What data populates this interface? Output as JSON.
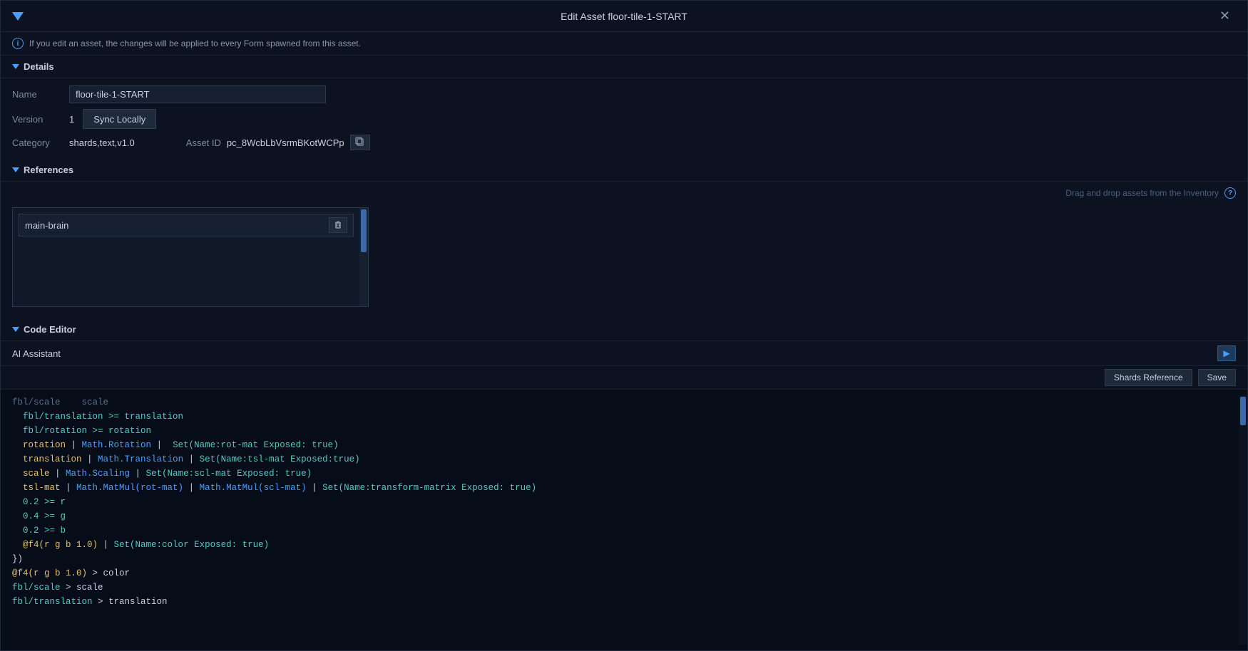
{
  "window": {
    "title": "Edit Asset floor-tile-1-START"
  },
  "info": {
    "message": "If you edit an asset, the changes will be applied to every Form spawned from this asset."
  },
  "details": {
    "section_label": "Details",
    "name_label": "Name",
    "name_value": "floor-tile-1-START",
    "version_label": "Version",
    "version_value": "1",
    "sync_btn_label": "Sync Locally",
    "category_label": "Category",
    "category_value": "shards,text,v1.0",
    "asset_id_label": "Asset ID",
    "asset_id_value": "pc_8WcbLbVsrmBKotWCPp"
  },
  "references": {
    "section_label": "References",
    "drag_hint": "Drag and drop assets from the Inventory",
    "items": [
      {
        "name": "main-brain"
      }
    ]
  },
  "code_editor": {
    "section_label": "Code Editor",
    "ai_assistant_label": "AI Assistant",
    "shards_ref_label": "Shards Reference",
    "save_label": "Save",
    "lines": [
      {
        "text": "fbl/scale    scale",
        "classes": [
          "c-gray"
        ]
      },
      {
        "parts": [
          {
            "text": "  fbl/translation >= translation",
            "cls": "c-cyan"
          }
        ]
      },
      {
        "parts": [
          {
            "text": "  fbl/rotation >= rotation",
            "cls": "c-cyan"
          }
        ]
      },
      {
        "parts": [
          {
            "text": "  rotation",
            "cls": "c-yellow"
          },
          {
            "text": " | ",
            "cls": "c-white"
          },
          {
            "text": "Math.Rotation",
            "cls": "c-blue"
          },
          {
            "text": " |  ",
            "cls": "c-white"
          },
          {
            "text": "Set(Name:rot-mat Exposed: true)",
            "cls": "c-cyan"
          }
        ]
      },
      {
        "parts": [
          {
            "text": "  translation",
            "cls": "c-yellow"
          },
          {
            "text": " | ",
            "cls": "c-white"
          },
          {
            "text": "Math.Translation",
            "cls": "c-blue"
          },
          {
            "text": " | ",
            "cls": "c-white"
          },
          {
            "text": "Set(Name:tsl-mat Exposed:true)",
            "cls": "c-cyan"
          }
        ]
      },
      {
        "parts": [
          {
            "text": "  scale",
            "cls": "c-yellow"
          },
          {
            "text": " | ",
            "cls": "c-white"
          },
          {
            "text": "Math.Scaling",
            "cls": "c-blue"
          },
          {
            "text": " | ",
            "cls": "c-white"
          },
          {
            "text": "Set(Name:scl-mat Exposed: true)",
            "cls": "c-cyan"
          }
        ]
      },
      {
        "parts": [
          {
            "text": "  tsl-mat",
            "cls": "c-yellow"
          },
          {
            "text": " | ",
            "cls": "c-white"
          },
          {
            "text": "Math.MatMul(rot-mat)",
            "cls": "c-blue"
          },
          {
            "text": " | ",
            "cls": "c-white"
          },
          {
            "text": "Math.MatMul(scl-mat)",
            "cls": "c-blue"
          },
          {
            "text": " | ",
            "cls": "c-white"
          },
          {
            "text": "Set(Name:transform-matrix Exposed: true)",
            "cls": "c-cyan"
          }
        ]
      },
      {
        "parts": [
          {
            "text": "  0.2 >= r",
            "cls": "c-cyan"
          }
        ]
      },
      {
        "parts": [
          {
            "text": "  0.4 >= g",
            "cls": "c-cyan"
          }
        ]
      },
      {
        "parts": [
          {
            "text": "  0.2 >= b",
            "cls": "c-cyan"
          }
        ]
      },
      {
        "parts": [
          {
            "text": "  @f4(r g b 1.0)",
            "cls": "c-yellow"
          },
          {
            "text": " | ",
            "cls": "c-white"
          },
          {
            "text": "Set(Name:color Exposed: true)",
            "cls": "c-cyan"
          }
        ]
      },
      {
        "parts": [
          {
            "text": "})",
            "cls": "c-white"
          }
        ]
      },
      {
        "parts": [
          {
            "text": "@f4(r g b 1.0)",
            "cls": "c-yellow"
          },
          {
            "text": " > color",
            "cls": "c-white"
          }
        ]
      },
      {
        "parts": [
          {
            "text": "fbl/scale",
            "cls": "c-cyan"
          },
          {
            "text": " > scale",
            "cls": "c-white"
          }
        ]
      },
      {
        "parts": [
          {
            "text": "fbl/translation",
            "cls": "c-cyan"
          },
          {
            "text": " > translation",
            "cls": "c-white"
          }
        ]
      }
    ]
  }
}
